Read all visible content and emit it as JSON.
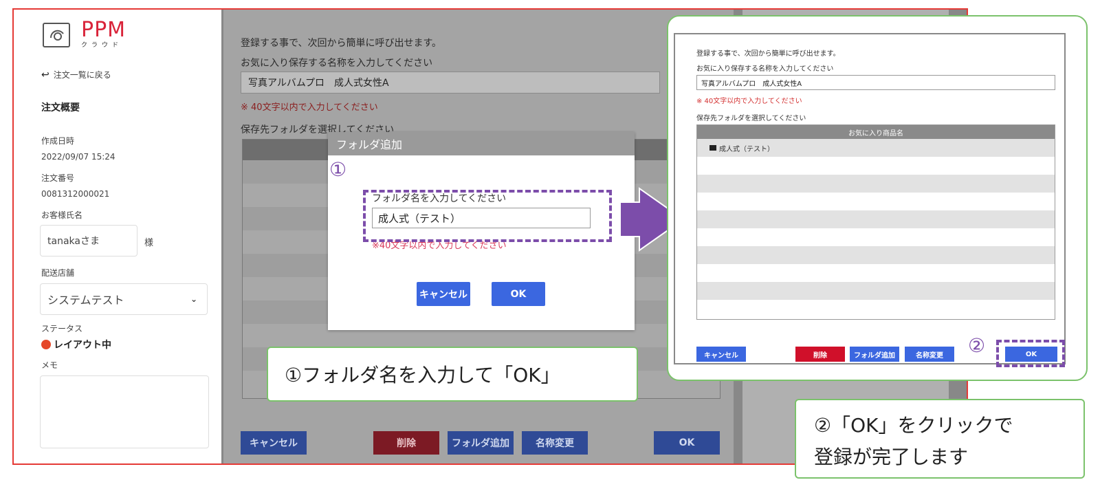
{
  "logo": {
    "name": "PPM",
    "sub": "クラウド"
  },
  "sidebar": {
    "back_link": "注文一覧に戻る",
    "section_title": "注文概要",
    "created_label": "作成日時",
    "created_value": "2022/09/07 15:24",
    "order_no_label": "注文番号",
    "order_no_value": "0081312000021",
    "customer_label": "お客様氏名",
    "customer_value": "tanakaさま",
    "customer_suffix": "様",
    "store_label": "配送店舗",
    "store_value": "システムテスト",
    "status_label": "ステータス",
    "status_value": "レイアウト中",
    "memo_label": "メモ"
  },
  "form": {
    "intro": "登録する事で、次回から簡単に呼び出せます。",
    "name_label": "お気に入り保存する名称を入力してください",
    "name_value": "写真アルバムプロ　成人式女性A",
    "name_note": "※ 40文字以内で入力してください",
    "folder_label": "保存先フォルダを選択してください",
    "cancel": "キャンセル",
    "delete": "削除",
    "add_folder": "フォルダ追加",
    "rename": "名称変更",
    "ok": "OK"
  },
  "modal": {
    "title": "フォルダ追加",
    "step_marker": "①",
    "input_label": "フォルダ名を入力してください",
    "input_value": "成人式（テスト）",
    "note": "※40文字以内で入力してください",
    "cancel": "キャンセル",
    "ok": "OK"
  },
  "callout1": "①フォルダ名を入力して「OK」",
  "shot": {
    "intro": "登録する事で、次回から簡単に呼び出せます。",
    "name_label": "お気に入り保存する名称を入力してください",
    "name_value": "写真アルバムプロ　成人式女性A",
    "name_note": "※ 40文字以内で入力してください",
    "folder_label": "保存先フォルダを選択してください",
    "table_header": "お気に入り商品名",
    "folder_item": "成人式（テスト）",
    "cancel": "キャンセル",
    "delete": "削除",
    "add_folder": "フォルダ追加",
    "rename": "名称変更",
    "step_marker": "②",
    "ok": "OK"
  },
  "callout2": {
    "line1": "②「OK」をクリックで",
    "line2": "登録が完了します"
  },
  "colors": {
    "frame": "#e53935",
    "purple": "#7c4daa",
    "green": "#7bc26b",
    "blue": "#3b67e0",
    "red_button": "#d0102a",
    "logo_red": "#d9243a"
  }
}
